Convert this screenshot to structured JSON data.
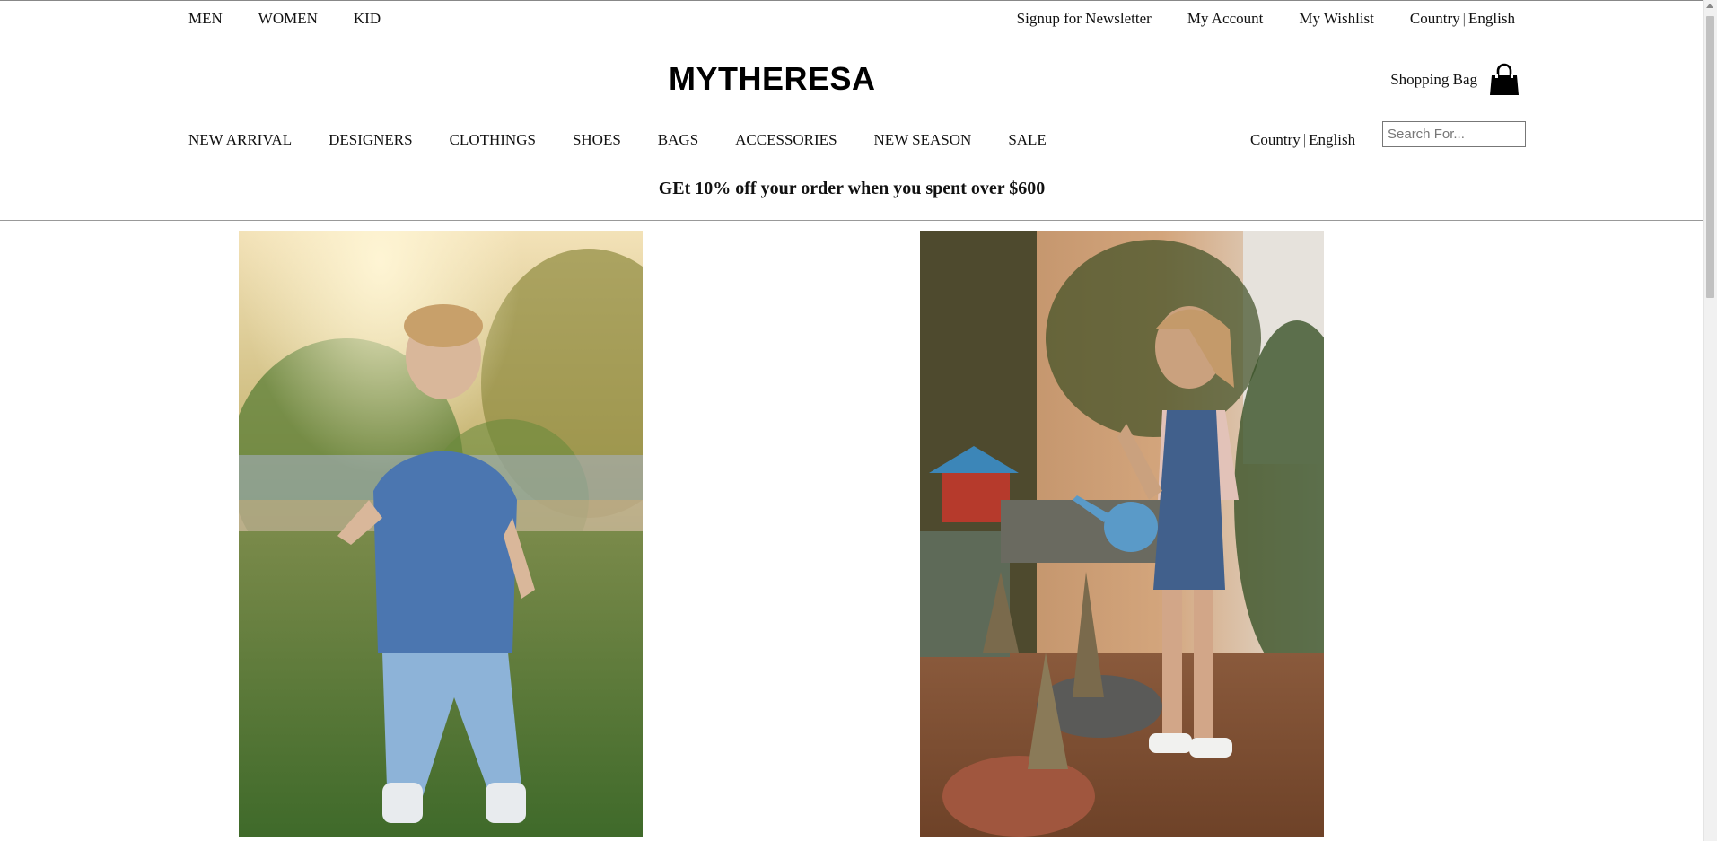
{
  "top_bar": {
    "left_links": [
      "MEN",
      "WOMEN",
      "KID"
    ],
    "right_links": [
      "Signup for Newsletter",
      "My Account",
      "My Wishlist"
    ],
    "country_label": "Country",
    "separator": "|",
    "language_label": "English"
  },
  "header": {
    "logo": "MYTHERESA",
    "bag_label": "Shopping Bag",
    "bag_icon": "shopping-bag-icon"
  },
  "main_nav": {
    "items": [
      "NEW ARRIVAL",
      "DESIGNERS",
      "CLOTHINGS",
      "SHOES",
      "BAGS",
      "ACCESSORIES",
      "NEW SEASON",
      "SALE"
    ],
    "country_label": "Country",
    "separator": "|",
    "language_label": "English"
  },
  "search": {
    "placeholder": "Search For...",
    "value": ""
  },
  "promo": {
    "text": "GEt 10% off your order when you spent over $600"
  },
  "hero": {
    "images": [
      "toddler-in-park-photo",
      "girl-watering-plants-photo"
    ]
  }
}
